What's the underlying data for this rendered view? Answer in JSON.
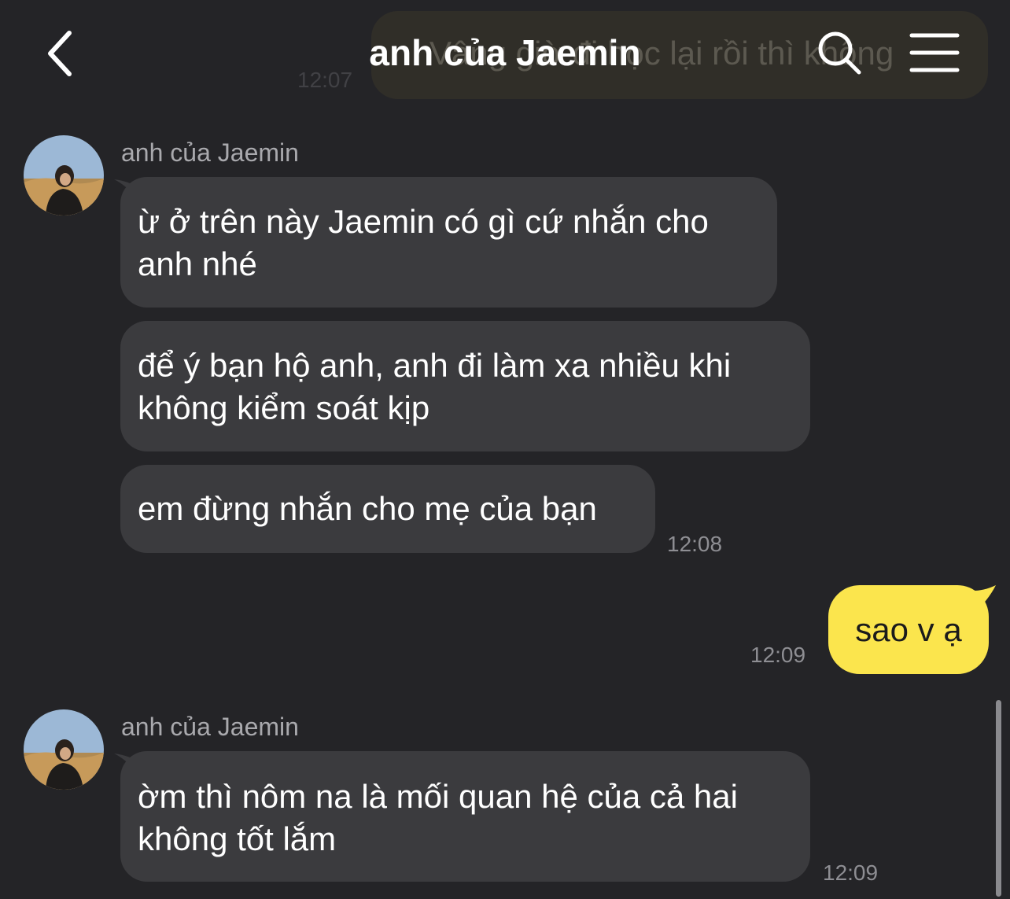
{
  "header": {
    "title": "anh của Jaemin",
    "back_icon": "chevron-left-icon",
    "search_icon": "search-icon",
    "menu_icon": "menu-icon"
  },
  "ghost_message": {
    "text": "Vâng giờ đi học lại rồi thì không",
    "time": "12:07"
  },
  "messages": [
    {
      "sender": "anh của Jaemin",
      "bubbles": [
        "ừ ở trên này Jaemin có gì cứ nhắn cho\nanh nhé",
        "để ý bạn hộ anh, anh đi làm xa nhiều khi\nkhông kiểm soát kịp",
        "em đừng nhắn cho mẹ của bạn"
      ],
      "time": "12:08"
    },
    {
      "outgoing": true,
      "text": "sao v ạ",
      "time": "12:09"
    },
    {
      "sender": "anh của Jaemin",
      "bubbles": [
        "ờm thì nôm na là mối quan hệ của cả hai\nkhông tốt lắm"
      ],
      "time": "12:09"
    }
  ],
  "colors": {
    "background": "#242427",
    "incoming_bubble": "#3b3b3e",
    "outgoing_bubble": "#fbe54d",
    "timestamp": "#8e8e93",
    "sender_name": "#a9a9ad"
  }
}
